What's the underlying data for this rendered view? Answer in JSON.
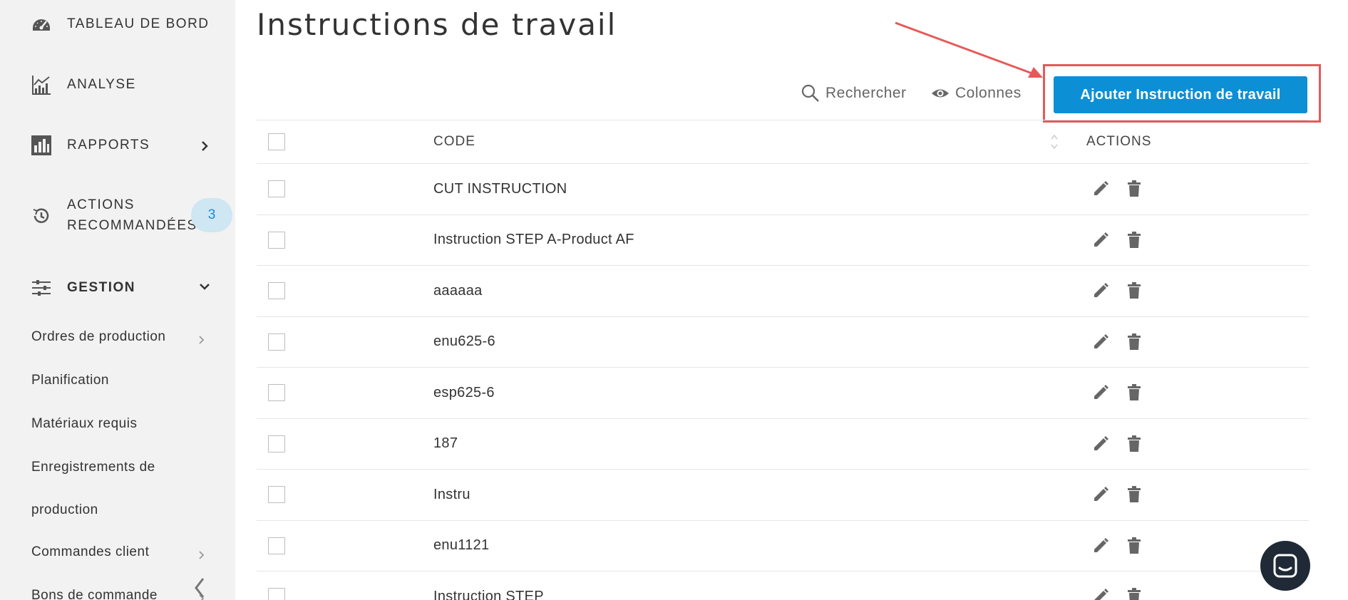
{
  "sidebar": {
    "dashboard_label": "TABLEAU DE BORD",
    "analyse_label": "ANALYSE",
    "rapports_label": "RAPPORTS",
    "actions_label_line1": "ACTIONS",
    "actions_label_line2": "RECOMMANDÉES",
    "actions_badge": "3",
    "gestion_label": "GESTION",
    "sub_items": [
      {
        "label": "Ordres de production",
        "has_chevron": true
      },
      {
        "label": "Planification",
        "has_chevron": false
      },
      {
        "label": "Matériaux requis",
        "has_chevron": false
      },
      {
        "label": "Enregistrements de",
        "has_chevron": false
      },
      {
        "label": "production",
        "has_chevron": false
      },
      {
        "label": "Commandes client",
        "has_chevron": true
      },
      {
        "label": "Bons de commande",
        "has_chevron": true
      }
    ]
  },
  "page": {
    "title": "Instructions de travail"
  },
  "toolbar": {
    "search_label": "Rechercher",
    "columns_label": "Colonnes",
    "add_label": "Ajouter Instruction de travail"
  },
  "table": {
    "headers": {
      "code": "CODE",
      "actions": "ACTIONS"
    },
    "rows": [
      {
        "code": "CUT INSTRUCTION"
      },
      {
        "code": "Instruction STEP A-Product AF"
      },
      {
        "code": "aaaaaa"
      },
      {
        "code": "enu625-6"
      },
      {
        "code": "esp625-6"
      },
      {
        "code": "187"
      },
      {
        "code": "Instru"
      },
      {
        "code": "enu1121"
      },
      {
        "code": "Instruction STEP"
      }
    ]
  },
  "colors": {
    "primary": "#0d8fd6",
    "highlight": "#e45a5a",
    "badge_bg": "#cfe6f3",
    "sidebar_bg": "#f2f2f2"
  }
}
